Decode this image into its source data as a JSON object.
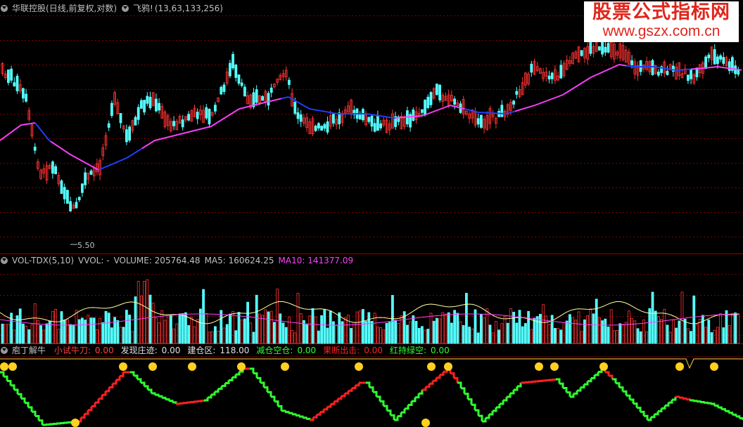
{
  "main_panel": {
    "stock_name": "华联控股",
    "period": "(日线,前复权,对数)",
    "indicator_name": "飞鸦!",
    "indicator_params": "(13,63,133,256)",
    "min_price_label": "5.50"
  },
  "volume_panel": {
    "indicator": "VOL-TDX(5,10)",
    "vvol": "VVOL: -",
    "volume": "VOLUME: 205764.48",
    "ma5": "MA5: 160624.25",
    "ma10": "MA10: 141377.09"
  },
  "signal_panel": {
    "title": "庖丁解牛",
    "items": [
      {
        "label": "小试牛刀:",
        "value": "0.00",
        "color": "#ff4040"
      },
      {
        "label": "发现庄迹:",
        "value": "0.00",
        "color": "#e0e0e0"
      },
      {
        "label": "建仓区:",
        "value": "118.00",
        "color": "#e0e0e0"
      },
      {
        "label": "减仓空仓:",
        "value": "0.00",
        "color": "#30ff30"
      },
      {
        "label": "果断出击:",
        "value": "0.00",
        "color": "#ff2020"
      },
      {
        "label": "红持绿空:",
        "value": "0.00",
        "color": "#30ff30"
      }
    ]
  },
  "watermark": {
    "line1": "股票公式指标网",
    "line2": "www.gszx.com.cn"
  },
  "colors": {
    "up": "#ff3232",
    "down": "#54ffff",
    "ma_up": "#ff40ff",
    "ma_down": "#2040ff",
    "grid": "#800000"
  }
}
